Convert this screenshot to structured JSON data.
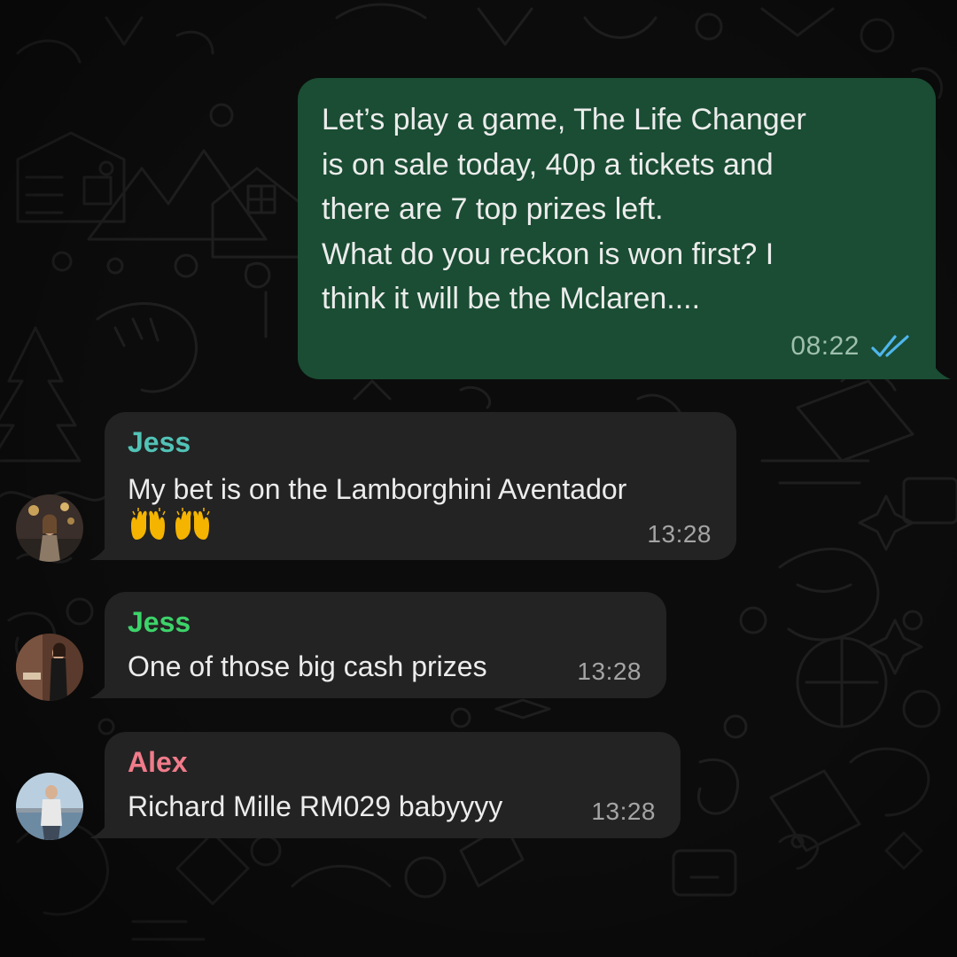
{
  "outgoing": {
    "lines": [
      "Let’s play a game, The Life Changer",
      "is on sale today, 40p a tickets and",
      "there are 7 top prizes left.",
      "What do you reckon is won first? I",
      "think it will be the Mclaren...."
    ],
    "time": "08:22",
    "status_icon": "double-check-read-icon",
    "bubble_color": "#1a4d33",
    "check_color": "#4fb6ec"
  },
  "incoming": [
    {
      "sender": "Jess",
      "sender_color": "#52c3b6",
      "text": "My bet is on the Lamborghini Aventador",
      "emoji": [
        "🙌",
        "🙌"
      ],
      "time": "13:28",
      "avatar": "avatar-photo"
    },
    {
      "sender": "Jess",
      "sender_color": "#3dd36a",
      "text": "One of those big cash prizes",
      "time": "13:28",
      "avatar": "avatar-photo"
    },
    {
      "sender": "Alex",
      "sender_color": "#f07b8a",
      "text": "Richard Mille RM029 babyyyy",
      "time": "13:28",
      "avatar": "avatar-photo"
    }
  ],
  "theme": {
    "incoming_bubble": "#232323",
    "background": "#0c0c0c"
  }
}
